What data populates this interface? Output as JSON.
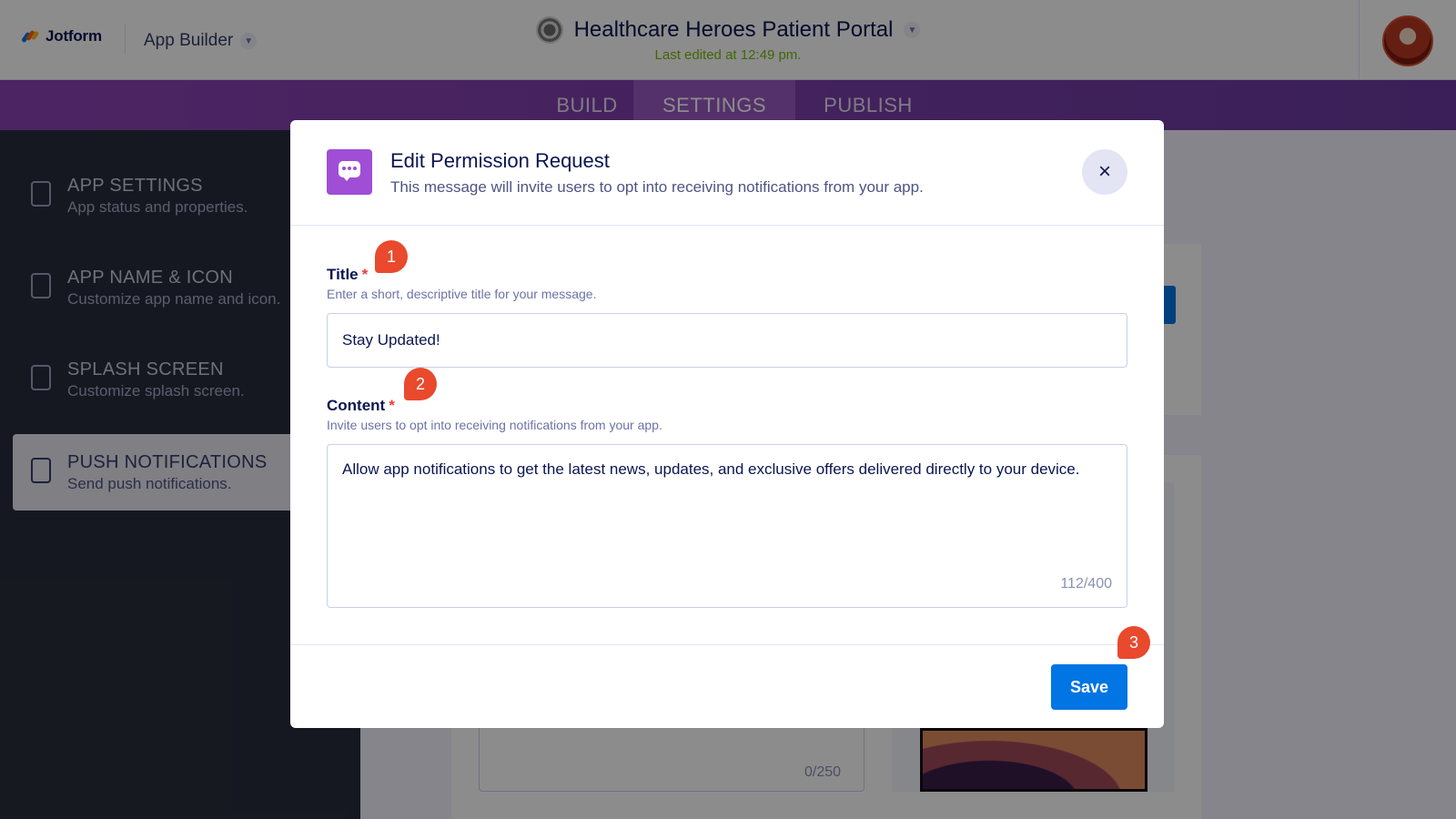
{
  "header": {
    "logo_text": "Jotform",
    "builder_label": "App Builder",
    "app_title": "Healthcare Heroes Patient Portal",
    "last_edited": "Last edited at 12:49 pm."
  },
  "tabs": [
    {
      "label": "BUILD",
      "active": false
    },
    {
      "label": "SETTINGS",
      "active": true
    },
    {
      "label": "PUBLISH",
      "active": false
    }
  ],
  "sidebar": {
    "items": [
      {
        "title": "APP SETTINGS",
        "desc": "App status and properties.",
        "icon": "app-settings-icon"
      },
      {
        "title": "APP NAME & ICON",
        "desc": "Customize app name and icon.",
        "icon": "app-name-icon"
      },
      {
        "title": "SPLASH SCREEN",
        "desc": "Customize splash screen.",
        "icon": "splash-screen-icon"
      },
      {
        "title": "PUSH NOTIFICATIONS",
        "desc": "Send push notifications.",
        "icon": "push-notifications-icon",
        "active": true
      }
    ]
  },
  "background": {
    "counter": "0/250"
  },
  "modal": {
    "title": "Edit Permission Request",
    "subtitle": "This message will invite users to opt into receiving notifications from your app.",
    "title_field": {
      "label": "Title",
      "required_mark": "*",
      "help": "Enter a short, descriptive title for your message.",
      "value": "Stay Updated!"
    },
    "content_field": {
      "label": "Content",
      "required_mark": "*",
      "help": "Invite users to opt into receiving notifications from your app.",
      "value": "Allow app notifications to get the latest news, updates, and exclusive offers delivered directly to your device.",
      "counter": "112/400"
    },
    "close_icon": "×",
    "save_label": "Save"
  },
  "markers": [
    "1",
    "2",
    "3"
  ],
  "colors": {
    "accent": "#0075e3",
    "purple": "#8d43b5",
    "marker": "#e9492c",
    "required": "#f23a3c"
  }
}
